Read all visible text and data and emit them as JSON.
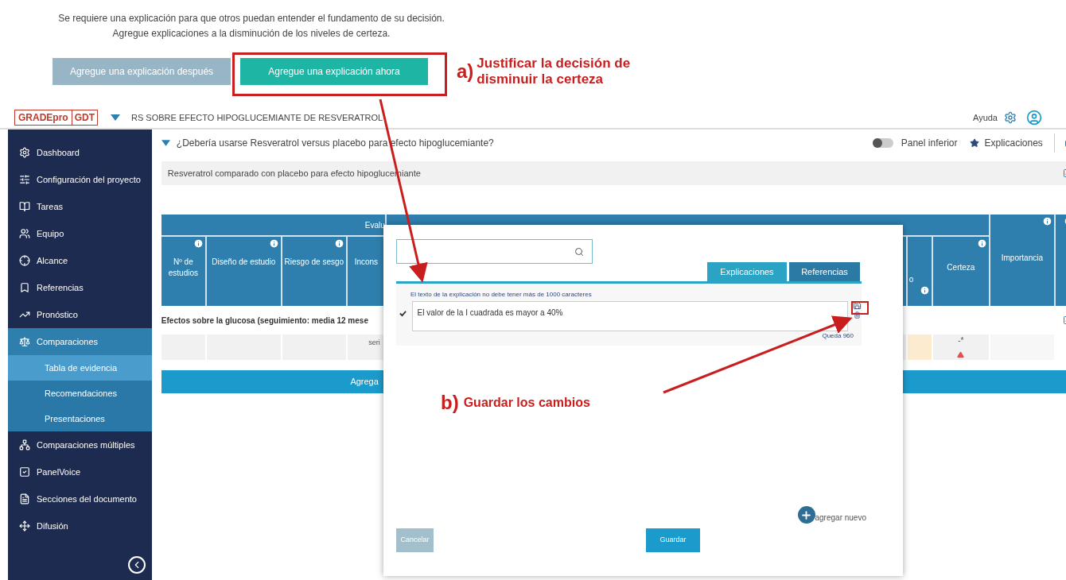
{
  "intro": {
    "text": "Se requiere una explicación para que otros puedan entender el fundamento de su decisión. Agregue explicaciones a la disminución de los niveles de certeza.",
    "buttons": [
      {
        "label": "Agregue una explicación después",
        "kind": "secondary"
      },
      {
        "label": "Agregue una explicación ahora",
        "kind": "primary"
      }
    ]
  },
  "annotations": [
    {
      "label": "a)",
      "text": "Justificar la decisión de disminuir la certeza"
    },
    {
      "label": "b)",
      "text": "Guardar los cambios"
    }
  ],
  "header": {
    "logo": {
      "main": "GRADEpro",
      "suffix": "GDT"
    },
    "project": "RS SOBRE EFECTO HIPOGLUCEMIANTE DE RESVERATROL",
    "help": "Ayuda"
  },
  "sidebar": {
    "items": [
      {
        "label": "Dashboard",
        "selected": false
      },
      {
        "label": "Configuración del proyecto",
        "selected": false
      },
      {
        "label": "Tareas",
        "selected": false
      },
      {
        "label": "Equipo",
        "selected": false
      },
      {
        "label": "Alcance",
        "selected": false
      },
      {
        "label": "Referencias",
        "selected": false
      },
      {
        "label": "Pronóstico",
        "selected": false
      },
      {
        "label": "Comparaciones",
        "selected": false,
        "expanded": true,
        "children": [
          {
            "label": "Tabla de evidencia",
            "selected": true
          },
          {
            "label": "Recomendaciones",
            "selected": false
          },
          {
            "label": "Presentaciones",
            "selected": false
          }
        ]
      },
      {
        "label": "Comparaciones múltiples",
        "selected": false
      },
      {
        "label": "PanelVoice",
        "selected": false
      },
      {
        "label": "Secciones del documento",
        "selected": false
      },
      {
        "label": "Difusión",
        "selected": false
      }
    ]
  },
  "question": {
    "text": "¿Debería usarse Resveratrol versus placebo para efecto hipoglucemiante?",
    "expanded": true,
    "toggle": {
      "label": "Panel inferior",
      "on": false
    },
    "explanations": "Explicaciones"
  },
  "subtitle": "Resveratrol comparado con placebo para efecto hipoglucemiante",
  "table": {
    "group_header": "Evalu",
    "columns": [
      {
        "label": "Nº de estudios",
        "info": true
      },
      {
        "label": "Diseño de estudio",
        "info": true
      },
      {
        "label": "Riesgo de sesgo",
        "info": true
      },
      {
        "label": "Incons",
        "info": false
      }
    ],
    "right_columns": [
      {
        "label": "o",
        "info": true
      },
      {
        "label": "Certeza",
        "info": true
      },
      {
        "label": "Importancia",
        "info": true
      }
    ],
    "outcome": "Efectos sobre la glucosa (seguimiento: media 12 mese",
    "row": {
      "column_4": "seri",
      "certainty": "-*"
    },
    "add_bar": "Agrega"
  },
  "modal": {
    "tabs": [
      {
        "label": "Explicaciones",
        "selected": true
      },
      {
        "label": "Referencias",
        "selected": false
      }
    ],
    "hint": "El texto de la explicación no debe tener más de 1000 caracteres",
    "entry": {
      "checked": true,
      "value": "El valor de la I cuadrada es mayor a 40%",
      "remaining": "Queda 960"
    },
    "add_new": "agregar nuevo",
    "cancel": "Cancelar",
    "save": "Guardar"
  }
}
